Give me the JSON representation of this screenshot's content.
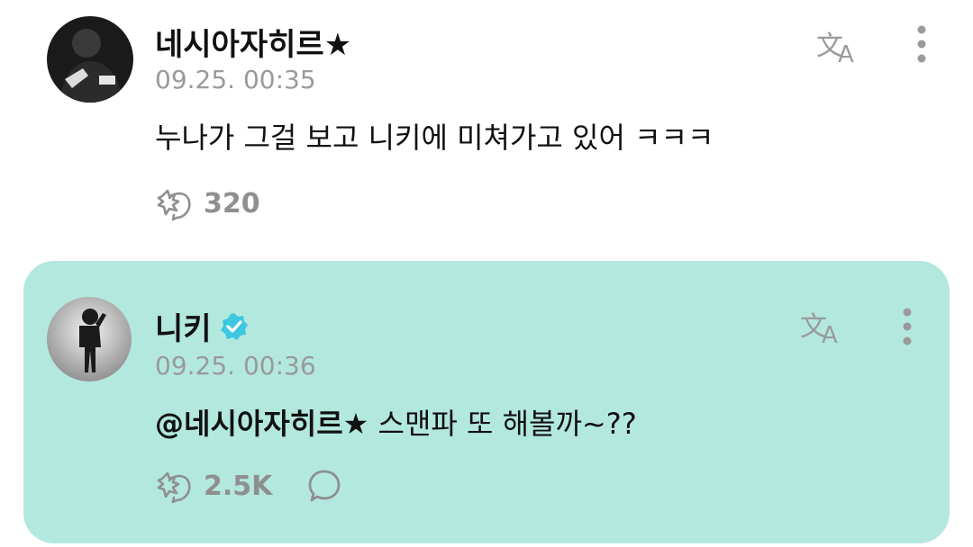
{
  "post": {
    "author": "네시아자히르★",
    "timestamp": "09.25. 00:35",
    "text": "누나가 그걸 보고 니키에 미쳐가고 있어 ㅋㅋㅋ",
    "like_count": "320",
    "icons": [
      "translate-icon",
      "more-vertical-icon",
      "like-icon"
    ]
  },
  "reply": {
    "author": "니키",
    "verified": true,
    "timestamp": "09.25. 00:36",
    "mention": "@네시아자히르★",
    "text": " 스맨파 또 해볼까~??",
    "like_count": "2.5K",
    "icons": [
      "translate-icon",
      "more-vertical-icon",
      "like-icon",
      "comment-icon",
      "verified-badge-icon"
    ]
  },
  "colors": {
    "reply_background": "#b3e8de",
    "verified_badge": "#3ec7e0",
    "muted_text": "#9a9a9a",
    "icon_gray": "#8f8f8f"
  }
}
